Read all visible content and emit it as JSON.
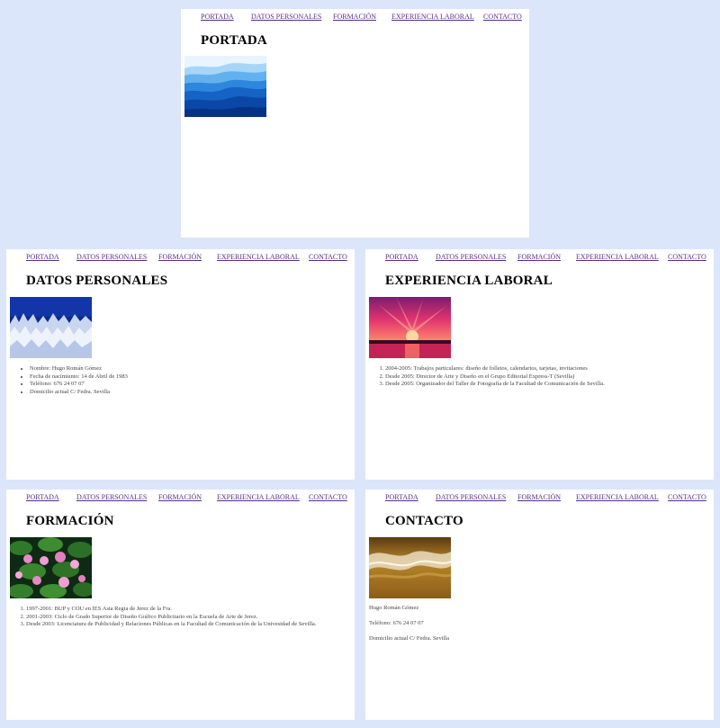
{
  "nav": [
    "PORTADA",
    "DATOS PERSONALES",
    "FORMACIÓN",
    "EXPERIENCIA LABORAL",
    "CONTACTO"
  ],
  "portada": {
    "title": "PORTADA",
    "image_icon": "mountains-photo-icon"
  },
  "datos": {
    "title": "DATOS PERSONALES",
    "image_icon": "frost-grass-photo-icon",
    "items": [
      "Nombre: Hugo Román Gómez",
      "Fecha de nacimiento: 14 de Abril de 1983",
      "Teléfono: 676 24 07 07",
      "Domicilio actual C/ Fedra. Sevilla"
    ]
  },
  "experiencia": {
    "title": "EXPERIENCIA LABORAL",
    "image_icon": "sunset-photo-icon",
    "items": [
      "2004-2005: Trabajos particulares: diseño de folletos, calendarios, tarjetas, invitaciones",
      "Desde 2005: Director de Arte y Diseño en el Grupo Editorial Express-T (Sevilla)",
      "Desde 2005: Organizador del Taller de Fotografía de la Facultad de Comunicación de Sevilla."
    ]
  },
  "formacion": {
    "title": "FORMACIÓN",
    "image_icon": "water-lilies-photo-icon",
    "items": [
      "1997-2001: BUP y COU en IES Asta Regia de Jerez de la Fra.",
      "2001-2003: Ciclo de Grado Superior de Diseño Gráfico Publicitario en la Escuela de Arte de Jerez.",
      "Desde 2003: Licenciatura de Publicidad y Relaciones Públicas en la Facultad de Comunicación de la Univesidad de Sevilla."
    ]
  },
  "contacto": {
    "title": "CONTACTO",
    "image_icon": "shoreline-photo-icon",
    "lines": [
      "Hugo Román Gómez",
      "Teléfono: 676 24 07 07",
      "Domicilio actual C/ Fedra. Sevilla"
    ]
  }
}
